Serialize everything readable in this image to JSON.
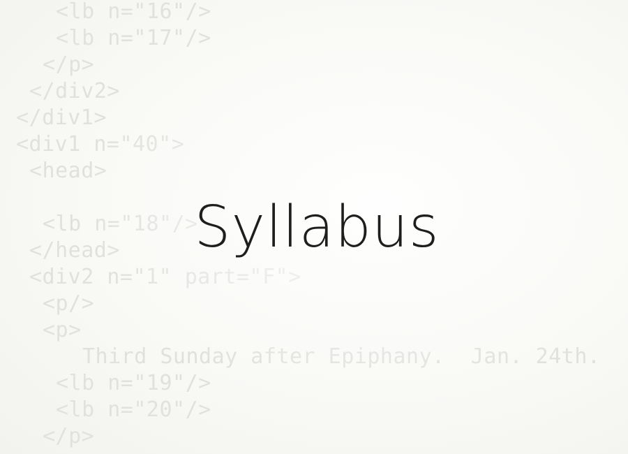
{
  "code_lines": [
    "<lb n=\"16\"/>",
    "<lb n=\"17\"/>",
    "</p>",
    "</div2>",
    "</div1>",
    "<div1 n=\"40\">",
    "<head>",
    "",
    "<lb n=\"18\"/>",
    "</head>",
    "<div2 n=\"1\" part=\"F\">",
    "<p/>",
    "<p>",
    "Third Sunday after Epiphany.  Jan. 24th.",
    "<lb n=\"19\"/>",
    "<lb n=\"20\"/>",
    "</p>"
  ],
  "title": "Syllabus"
}
